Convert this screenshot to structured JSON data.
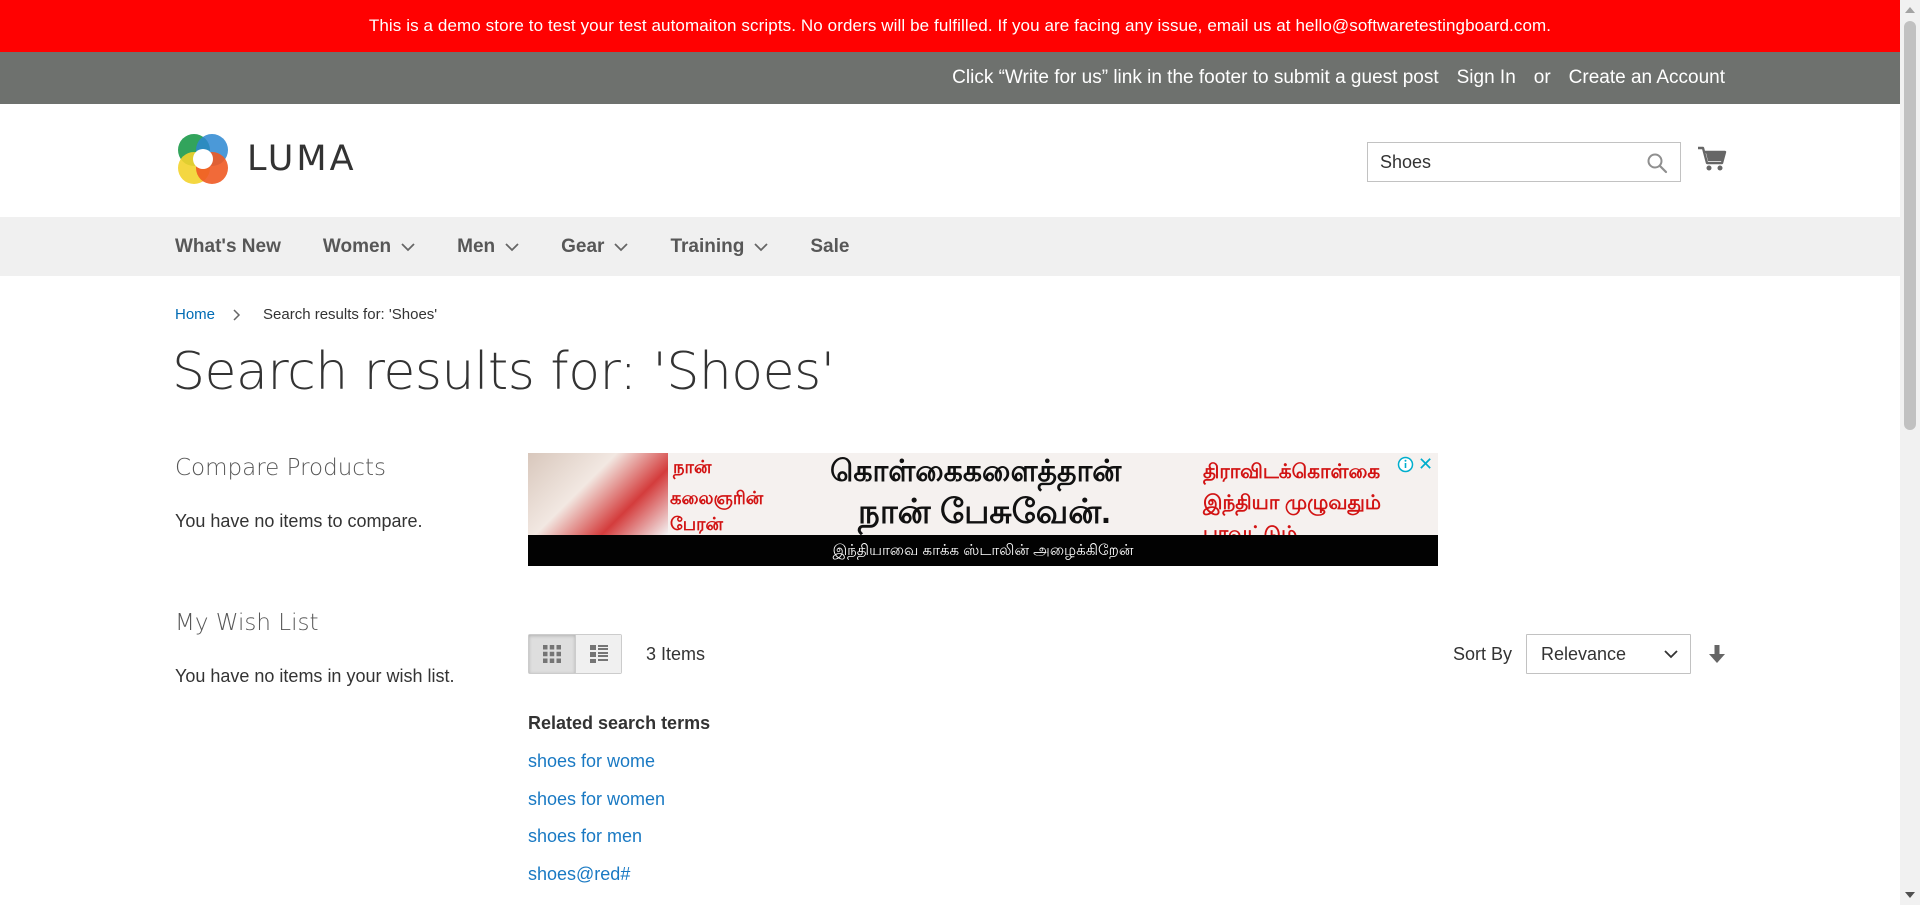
{
  "demo_notice": "This is a demo store to test your test automaiton scripts. No orders will be fulfilled. If you are facing any issue, email us at hello@softwaretestingboard.com.",
  "header_links": {
    "welcome": "Click “Write for us” link in the footer to submit a guest post",
    "sign_in": "Sign In",
    "or": "or",
    "create_account": "Create an Account"
  },
  "logo": {
    "text": "LUMA"
  },
  "search": {
    "value": "Shoes",
    "icon": "search-icon"
  },
  "cart": {
    "icon": "cart-icon"
  },
  "nav": {
    "items": [
      {
        "label": "What's New",
        "has_submenu": false
      },
      {
        "label": "Women",
        "has_submenu": true
      },
      {
        "label": "Men",
        "has_submenu": true
      },
      {
        "label": "Gear",
        "has_submenu": true
      },
      {
        "label": "Training",
        "has_submenu": true
      },
      {
        "label": "Sale",
        "has_submenu": false
      }
    ]
  },
  "breadcrumbs": {
    "home": "Home",
    "current": "Search results for: 'Shoes'"
  },
  "page_title": "Search results for: 'Shoes'",
  "sidebar": {
    "compare_title": "Compare Products",
    "compare_text": "You have no items to compare.",
    "wishlist_title": "My Wish List",
    "wishlist_text": "You have no items in your wish list."
  },
  "ad": {
    "line_red_a": "நான்",
    "line_red_b": "கலைஞரின்",
    "line_red_c": "பேரன்",
    "line_black_a": "கொள்கைகளைத்தான்",
    "line_black_b": "நான் பேசுவேன்.",
    "line_red_d": "திராவிடக்கொள்கை",
    "line_red_e": "இந்தியா முழுவதும்",
    "line_red_f": "பரவட்டும்",
    "bottom": "இந்தியாவை காக்க ஸ்டாலின் அழைக்கிறேன்",
    "close": "✕"
  },
  "toolbar": {
    "modes": [
      "Grid",
      "List"
    ],
    "active_mode": "Grid",
    "amount": "3 Items",
    "sort_label": "Sort By",
    "sort_value": "Relevance"
  },
  "related": {
    "title": "Related search terms",
    "terms": [
      "shoes for wome",
      "shoes for women",
      "shoes for men",
      "shoes@red#"
    ]
  },
  "colors": {
    "demo_bar": "#ff0101",
    "panel_header": "#6e716e",
    "link": "#1979c3",
    "nav_bg": "#f0f0f0"
  }
}
